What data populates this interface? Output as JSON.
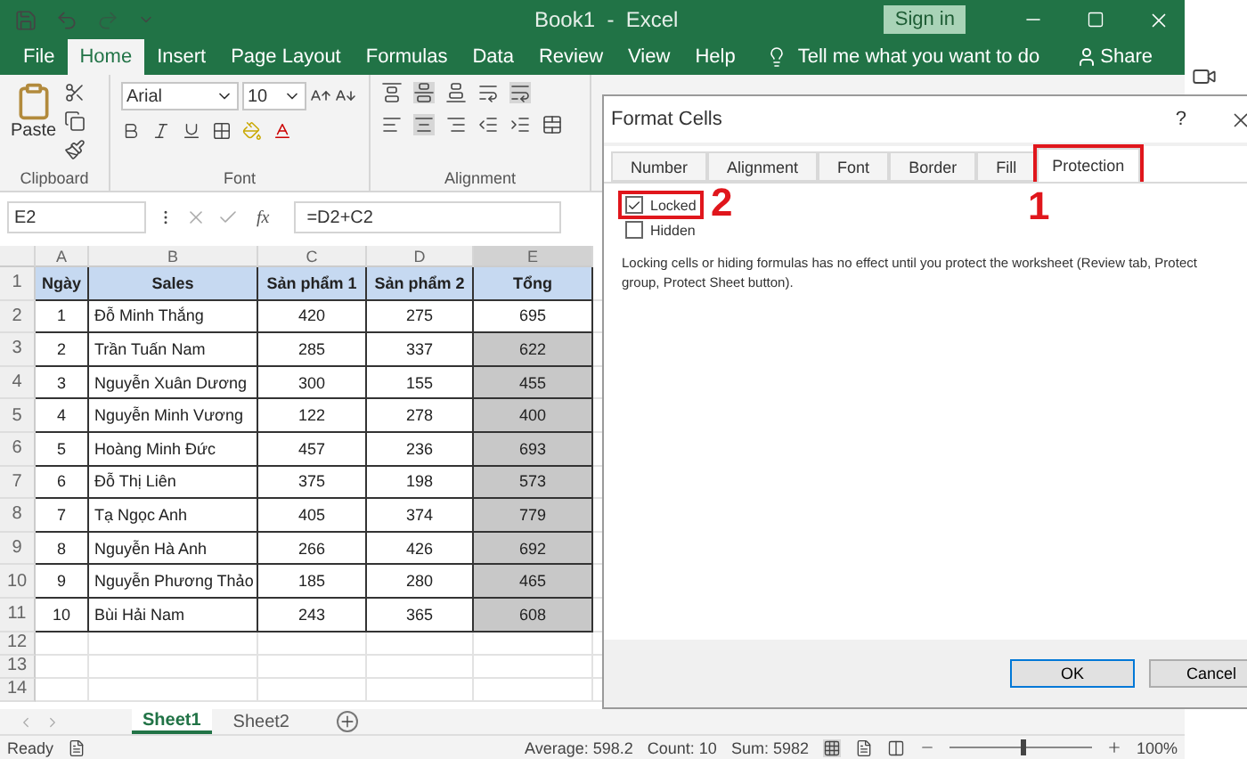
{
  "window": {
    "title": "Book1  -  Excel",
    "sign_in": "Sign in"
  },
  "ribbon_tabs": [
    {
      "label": "File",
      "selected": false
    },
    {
      "label": "Home",
      "selected": true
    },
    {
      "label": "Insert",
      "selected": false
    },
    {
      "label": "Page Layout",
      "selected": false
    },
    {
      "label": "Formulas",
      "selected": false
    },
    {
      "label": "Data",
      "selected": false
    },
    {
      "label": "Review",
      "selected": false
    },
    {
      "label": "View",
      "selected": false
    },
    {
      "label": "Help",
      "selected": false
    }
  ],
  "tell_me": "Tell me what you want to do",
  "share": "Share",
  "ribbon": {
    "paste": "Paste",
    "font_name": "Arial",
    "font_size": "10",
    "groups": [
      "Clipboard",
      "Font",
      "Alignment"
    ]
  },
  "formula_bar": {
    "name_box": "E2",
    "fx": "fx",
    "formula": "=D2+C2"
  },
  "sheet": {
    "columns": [
      {
        "label": "A",
        "selected": false
      },
      {
        "label": "B",
        "selected": false
      },
      {
        "label": "C",
        "selected": false
      },
      {
        "label": "D",
        "selected": false
      },
      {
        "label": "E",
        "selected": true
      }
    ],
    "header": {
      "number": "1",
      "cells": [
        "Ngày",
        "Sales",
        "Sản phẩm 1",
        "Sản phẩm 2",
        "Tổng"
      ]
    },
    "rows": [
      {
        "number": "2",
        "cells": [
          "1",
          "Đỗ Minh Thắng",
          "420",
          "275",
          "695"
        ],
        "total_highlighted": false
      },
      {
        "number": "3",
        "cells": [
          "2",
          "Trần Tuấn Nam",
          "285",
          "337",
          "622"
        ],
        "total_highlighted": true
      },
      {
        "number": "4",
        "cells": [
          "3",
          "Nguyễn Xuân Dương",
          "300",
          "155",
          "455"
        ],
        "total_highlighted": true
      },
      {
        "number": "5",
        "cells": [
          "4",
          "Nguyễn Minh Vương",
          "122",
          "278",
          "400"
        ],
        "total_highlighted": true
      },
      {
        "number": "6",
        "cells": [
          "5",
          "Hoàng Minh Đức",
          "457",
          "236",
          "693"
        ],
        "total_highlighted": true
      },
      {
        "number": "7",
        "cells": [
          "6",
          "Đỗ Thị Liên",
          "375",
          "198",
          "573"
        ],
        "total_highlighted": true
      },
      {
        "number": "8",
        "cells": [
          "7",
          "Tạ Ngọc Anh",
          "405",
          "374",
          "779"
        ],
        "total_highlighted": true
      },
      {
        "number": "9",
        "cells": [
          "8",
          "Nguyễn Hà Anh",
          "266",
          "426",
          "692"
        ],
        "total_highlighted": true
      },
      {
        "number": "10",
        "cells": [
          "9",
          "Nguyễn Phương Thảo",
          "185",
          "280",
          "465"
        ],
        "total_highlighted": true
      },
      {
        "number": "11",
        "cells": [
          "10",
          "Bùi Hải Nam",
          "243",
          "365",
          "608"
        ],
        "total_highlighted": true
      }
    ],
    "empty_rows": [
      "12",
      "13",
      "14"
    ]
  },
  "sheet_tabs": [
    {
      "label": "Sheet1",
      "selected": true
    },
    {
      "label": "Sheet2",
      "selected": false
    }
  ],
  "status_bar": {
    "ready": "Ready",
    "average": "Average: 598.2",
    "count": "Count: 10",
    "sum": "Sum: 5982",
    "zoom": "100%",
    "zoom_level": {
      "level": 0.5
    }
  },
  "dialog": {
    "title": "Format Cells",
    "help": "?",
    "tabs": [
      {
        "label": "Number",
        "selected": false
      },
      {
        "label": "Alignment",
        "selected": false
      },
      {
        "label": "Font",
        "selected": false
      },
      {
        "label": "Border",
        "selected": false
      },
      {
        "label": "Fill",
        "selected": false
      },
      {
        "label": "Protection",
        "selected": true
      }
    ],
    "options": [
      {
        "label": "Locked",
        "checked": true
      },
      {
        "label": "Hidden",
        "checked": false
      }
    ],
    "description": "Locking cells or hiding formulas has no effect until you protect the worksheet (Review tab, Protect group, Protect Sheet button).",
    "ok": "OK",
    "cancel": "Cancel",
    "annotations": [
      "2",
      "1"
    ]
  }
}
